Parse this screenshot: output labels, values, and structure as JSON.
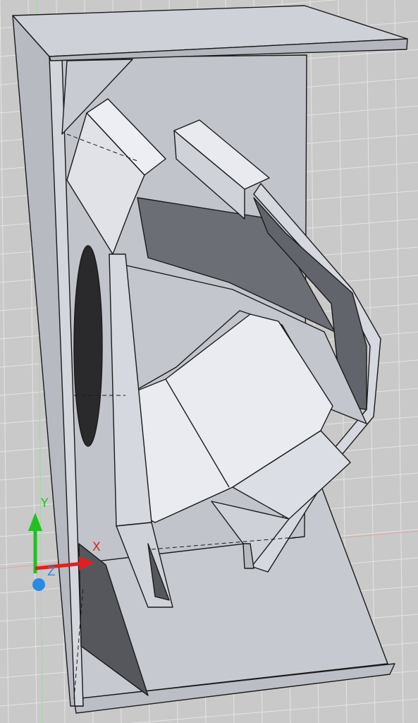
{
  "viewport": {
    "background": "#c9c9c9",
    "grid_color": "#e4e4e4",
    "grid_on": true
  },
  "ucs": {
    "x_label": "X",
    "y_label": "Y",
    "z_label": "Z",
    "x_color": "#e02020",
    "y_color": "#22c022",
    "z_color": "#2a8ae0"
  },
  "model": {
    "face_light": "#e6e8ee",
    "face_mid": "#c8cad2",
    "face_dark": "#55575d",
    "edge_color": "#1a1a1a"
  }
}
